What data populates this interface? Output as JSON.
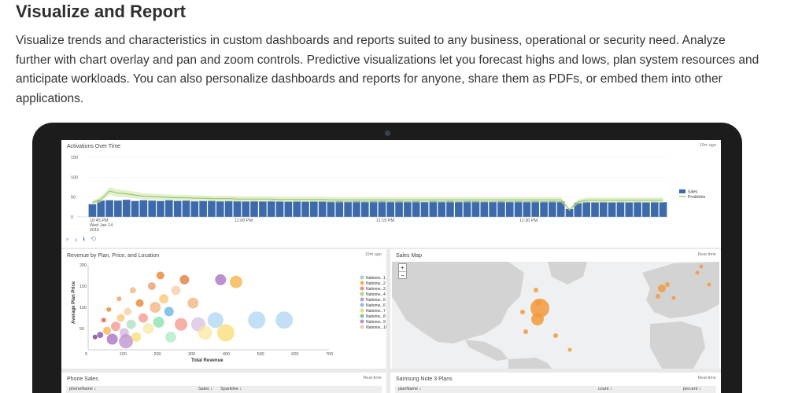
{
  "section": {
    "title": "Visualize and Report",
    "description": "Visualize trends and characteristics in custom dashboards and reports suited to any business, operational or security need. Analyze further with chart overlay and pan and zoom controls. Predictive visualizations let you forecast highs and lows, plan system resources and anticipate workloads. You can also personalize dashboards and reports for anyone, share them as PDFs, or embed them into other applications."
  },
  "colors": {
    "screen_bezel": "#1c1c1c",
    "bar_blue": "#3d6aab",
    "prediction_green": "#b6d58a",
    "map_land": "#d3d3d3",
    "map_water": "#eef0f1",
    "bubble_orange": "#f29a3d"
  },
  "dashboard": {
    "activations": {
      "title": "Activations Over Time",
      "timestamp": "19m ago",
      "time_labels": {
        "first": "10:45 PM",
        "first_day": "Wed Jan 14",
        "first_year": "2015",
        "second": "11:00 PM",
        "third": "11:15 PM",
        "fourth": "11:30 PM"
      },
      "toolbar": "⌕ ⤓ ℹ ⟲"
    },
    "revenue": {
      "title": "Revenue by Plan, Price, and Location",
      "timestamp": "19m ago"
    },
    "sales_map": {
      "title": "Sales Map",
      "timestamp": "Real-time",
      "zoom_in": "+",
      "zoom_out": "−",
      "bubbles": [
        {
          "region": "Pacific coast",
          "size": "large"
        },
        {
          "region": "Texas",
          "size": "large"
        },
        {
          "region": "Europe",
          "size": "medium"
        },
        {
          "region": "Scandinavia",
          "size": "small"
        }
      ]
    },
    "phone_sales": {
      "title": "Phone Sales",
      "timestamp": "Real-time",
      "columns": [
        "phoneName ↕",
        "Sales ↕",
        "Sparkline ↕"
      ]
    },
    "note3_plans": {
      "title": "Samsung Note 3 Plans",
      "timestamp": "Real-time",
      "columns": [
        "planName ↕",
        "count ↕",
        "percent ↕"
      ]
    }
  },
  "chart_data": [
    {
      "type": "bar",
      "title": "Activations Over Time",
      "ylim": [
        0,
        150
      ],
      "yticks": [
        "150",
        "100",
        "50",
        "0"
      ],
      "legend": [
        "Sales",
        "Prediction"
      ],
      "legend_position": "right",
      "series": [
        {
          "name": "Sales",
          "values": [
            32,
            41,
            42,
            41,
            43,
            40,
            42,
            41,
            40,
            42,
            40,
            41,
            39,
            40,
            41,
            39,
            40,
            40,
            39,
            40,
            39,
            40,
            40,
            39,
            40,
            39,
            40,
            40,
            39,
            40,
            39,
            40,
            39,
            40,
            40,
            39,
            40,
            39,
            40,
            38,
            40,
            39,
            40,
            39,
            40,
            40,
            39,
            39,
            40,
            39,
            40,
            39,
            40,
            39,
            40,
            39,
            20,
            36,
            38,
            37,
            38,
            37,
            38,
            37,
            38,
            37,
            38,
            37
          ]
        },
        {
          "name": "Prediction",
          "values": [
            36,
            44,
            65,
            60,
            58,
            55,
            52,
            51,
            50,
            49,
            48,
            48,
            47,
            47,
            46,
            46,
            46,
            45,
            45,
            45,
            45,
            45,
            44,
            44,
            44,
            44,
            44,
            44,
            43,
            43,
            43,
            43,
            43,
            43,
            43,
            43,
            43,
            43,
            43,
            43,
            43,
            43,
            43,
            43,
            43,
            43,
            43,
            43,
            43,
            43,
            43,
            43,
            43,
            43,
            43,
            43,
            18,
            38,
            42,
            42,
            42,
            42,
            42,
            42,
            42,
            42,
            42,
            42
          ]
        }
      ]
    },
    {
      "type": "scatter",
      "title": "Revenue by Plan, Price, and Location",
      "xlabel": "Total Revenue",
      "ylabel": "Average Plan Price",
      "xlim": [
        0,
        700
      ],
      "ylim": [
        0,
        200
      ],
      "xticks": [
        "0",
        "100",
        "200",
        "300",
        "400",
        "500",
        "600",
        "700"
      ],
      "yticks": [
        "200",
        "150",
        "100",
        "50"
      ],
      "legend": [
        "Nationw...1",
        "Nationw...2",
        "Nationw...3",
        "Nationw...4",
        "Nationw...5",
        "Nationw...6",
        "Nationw...7",
        "Nationw...8",
        "Nationw...9",
        "Nationw...10"
      ],
      "legend_colors": [
        "#9fd3e6",
        "#f5b041",
        "#f08c8c",
        "#b0d87a",
        "#c39bd3",
        "#85c1e9",
        "#f7dc6f",
        "#82c39a",
        "#bb8fce",
        "#f5cba7"
      ],
      "points": [
        {
          "x": 20,
          "y": 30,
          "r": 3,
          "c": "#6c3483"
        },
        {
          "x": 35,
          "y": 35,
          "r": 4,
          "c": "#8e44ad"
        },
        {
          "x": 45,
          "y": 70,
          "r": 3,
          "c": "#e74c3c"
        },
        {
          "x": 55,
          "y": 45,
          "r": 5,
          "c": "#f5b041"
        },
        {
          "x": 60,
          "y": 95,
          "r": 3,
          "c": "#e67e22"
        },
        {
          "x": 70,
          "y": 25,
          "r": 7,
          "c": "#a569bd"
        },
        {
          "x": 80,
          "y": 55,
          "r": 6,
          "c": "#f1948a"
        },
        {
          "x": 90,
          "y": 120,
          "r": 3,
          "c": "#e59866"
        },
        {
          "x": 95,
          "y": 75,
          "r": 5,
          "c": "#f8c471"
        },
        {
          "x": 105,
          "y": 40,
          "r": 6,
          "c": "#d2b4de"
        },
        {
          "x": 110,
          "y": 20,
          "r": 9,
          "c": "#bb8fce"
        },
        {
          "x": 115,
          "y": 90,
          "r": 5,
          "c": "#f5cba7"
        },
        {
          "x": 125,
          "y": 60,
          "r": 6,
          "c": "#a9dfbf"
        },
        {
          "x": 130,
          "y": 140,
          "r": 4,
          "c": "#f0b27a"
        },
        {
          "x": 140,
          "y": 30,
          "r": 6,
          "c": "#f7dc6f"
        },
        {
          "x": 150,
          "y": 110,
          "r": 5,
          "c": "#e67e22"
        },
        {
          "x": 160,
          "y": 75,
          "r": 6,
          "c": "#f1948a"
        },
        {
          "x": 175,
          "y": 50,
          "r": 7,
          "c": "#f9e79f"
        },
        {
          "x": 185,
          "y": 150,
          "r": 5,
          "c": "#e59866"
        },
        {
          "x": 195,
          "y": 100,
          "r": 7,
          "c": "#f0b27a"
        },
        {
          "x": 205,
          "y": 65,
          "r": 7,
          "c": "#82e0aa"
        },
        {
          "x": 210,
          "y": 175,
          "r": 5,
          "c": "#e67e22"
        },
        {
          "x": 220,
          "y": 120,
          "r": 6,
          "c": "#f8c471"
        },
        {
          "x": 235,
          "y": 90,
          "r": 6,
          "c": "#5dade2"
        },
        {
          "x": 240,
          "y": 30,
          "r": 7,
          "c": "#abebc6"
        },
        {
          "x": 255,
          "y": 140,
          "r": 6,
          "c": "#f5cba7"
        },
        {
          "x": 270,
          "y": 60,
          "r": 8,
          "c": "#f1948a"
        },
        {
          "x": 280,
          "y": 165,
          "r": 6,
          "c": "#dc7633"
        },
        {
          "x": 305,
          "y": 110,
          "r": 7,
          "c": "#f0b27a"
        },
        {
          "x": 320,
          "y": 60,
          "r": 9,
          "c": "#d7bde2"
        },
        {
          "x": 340,
          "y": 40,
          "r": 9,
          "c": "#f9e79f"
        },
        {
          "x": 370,
          "y": 70,
          "r": 10,
          "c": "#aed6f1"
        },
        {
          "x": 385,
          "y": 165,
          "r": 7,
          "c": "#a569bd"
        },
        {
          "x": 400,
          "y": 40,
          "r": 11,
          "c": "#f7dc6f"
        },
        {
          "x": 430,
          "y": 160,
          "r": 8,
          "c": "#f5b041"
        },
        {
          "x": 490,
          "y": 70,
          "r": 11,
          "c": "#aed6f1"
        },
        {
          "x": 570,
          "y": 70,
          "r": 11,
          "c": "#aed6f1"
        }
      ]
    }
  ]
}
